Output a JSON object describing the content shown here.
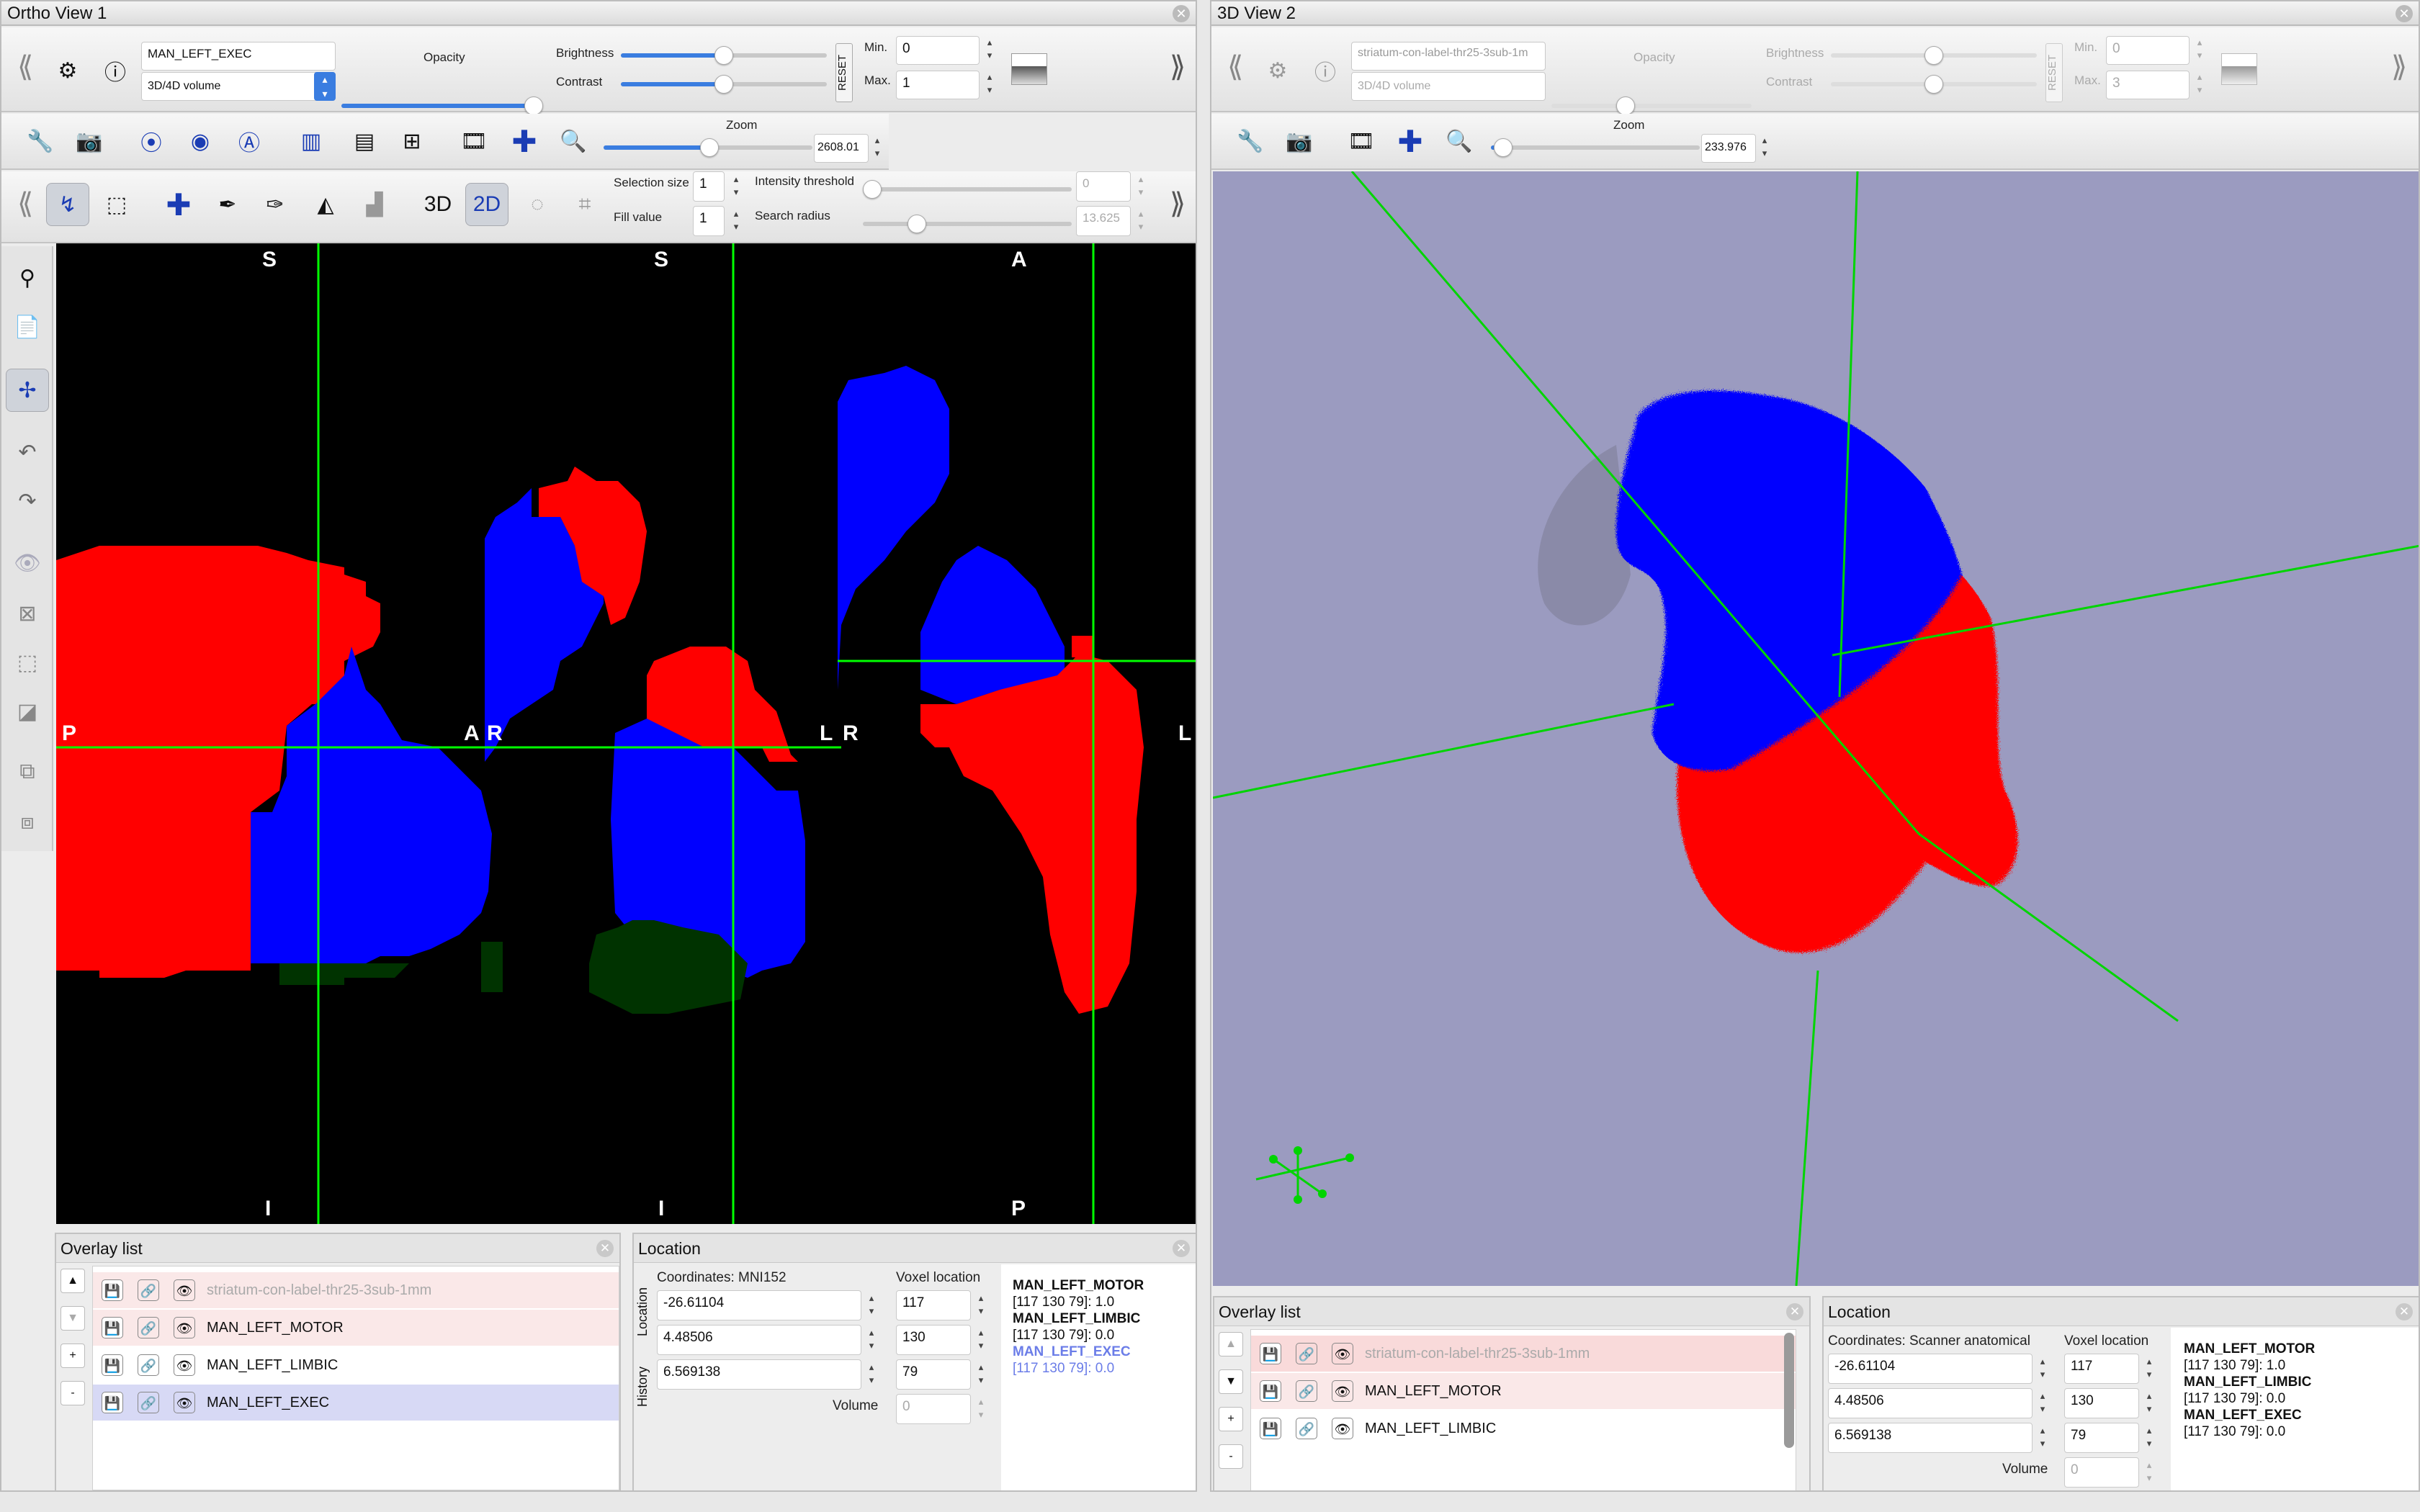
{
  "left_window": {
    "title": "Ortho View 1",
    "overlay_name": "MAN_LEFT_EXEC",
    "overlay_type": "3D/4D volume",
    "opacity_label": "Opacity",
    "brightness_label": "Brightness",
    "contrast_label": "Contrast",
    "reset_label": "RESET",
    "min_label": "Min.",
    "max_label": "Max.",
    "min_value": "0",
    "max_value": "1",
    "zoom_label": "Zoom",
    "zoom_value": "2608.01",
    "selection_size_label": "Selection size",
    "selection_size_value": "1",
    "fill_value_label": "Fill value",
    "fill_value": "1",
    "intensity_threshold_label": "Intensity threshold",
    "intensity_threshold_value": "0",
    "search_radius_label": "Search radius",
    "search_radius_value": "13.625",
    "btn_3d": "3D",
    "btn_2d": "2D",
    "views": [
      {
        "top": "S",
        "bottom": "I",
        "left": "P",
        "right": "A"
      },
      {
        "top": "S",
        "bottom": "I",
        "left": "R",
        "right": "L"
      },
      {
        "top": "A",
        "bottom": "P",
        "left": "R",
        "right": "L"
      }
    ],
    "overlay_list": {
      "title": "Overlay list",
      "items": [
        "striatum-con-label-thr25-3sub-1mm",
        "MAN_LEFT_MOTOR",
        "MAN_LEFT_LIMBIC",
        "MAN_LEFT_EXEC"
      ]
    },
    "location": {
      "title": "Location",
      "coords_label": "Coordinates: MNI152",
      "voxel_label": "Voxel location",
      "tab_location": "Location",
      "tab_history": "History",
      "coords": [
        "-26.61104",
        "4.48506",
        "6.569138"
      ],
      "voxels": [
        "117",
        "130",
        "79"
      ],
      "volume_label": "Volume",
      "volume_value": "0",
      "info": [
        {
          "name": "MAN_LEFT_MOTOR",
          "value": "[117 130 79]: 1.0"
        },
        {
          "name": "MAN_LEFT_LIMBIC",
          "value": "[117 130 79]: 0.0"
        },
        {
          "name": "MAN_LEFT_EXEC",
          "value": "[117 130 79]: 0.0"
        }
      ]
    }
  },
  "right_window": {
    "title": "3D View 2",
    "overlay_name": "striatum-con-label-thr25-3sub-1m",
    "overlay_type": "3D/4D volume",
    "opacity_label": "Opacity",
    "brightness_label": "Brightness",
    "contrast_label": "Contrast",
    "reset_label": "RESET",
    "min_label": "Min.",
    "max_label": "Max.",
    "min_value": "0",
    "max_value": "3",
    "zoom_label": "Zoom",
    "zoom_value": "233.976",
    "overlay_list": {
      "title": "Overlay list",
      "items": [
        "striatum-con-label-thr25-3sub-1mm",
        "MAN_LEFT_MOTOR",
        "MAN_LEFT_LIMBIC"
      ]
    },
    "location": {
      "title": "Location",
      "coords_label": "Coordinates: Scanner anatomical",
      "voxel_label": "Voxel location",
      "coords": [
        "-26.61104",
        "4.48506",
        "6.569138"
      ],
      "voxels": [
        "117",
        "130",
        "79"
      ],
      "volume_label": "Volume",
      "volume_value": "0",
      "info": [
        {
          "name": "MAN_LEFT_MOTOR",
          "value": "[117 130 79]: 1.0"
        },
        {
          "name": "MAN_LEFT_LIMBIC",
          "value": "[117 130 79]: 0.0"
        },
        {
          "name": "MAN_LEFT_EXEC",
          "value": "[117 130 79]: 0.0"
        }
      ]
    }
  },
  "colors": {
    "motor": "#ff0000",
    "limbic": "#0000ff",
    "exec": "#003300",
    "cursor": "#00ff00",
    "bg3d": "#9b9bc0",
    "accent": "#3a7de0"
  }
}
